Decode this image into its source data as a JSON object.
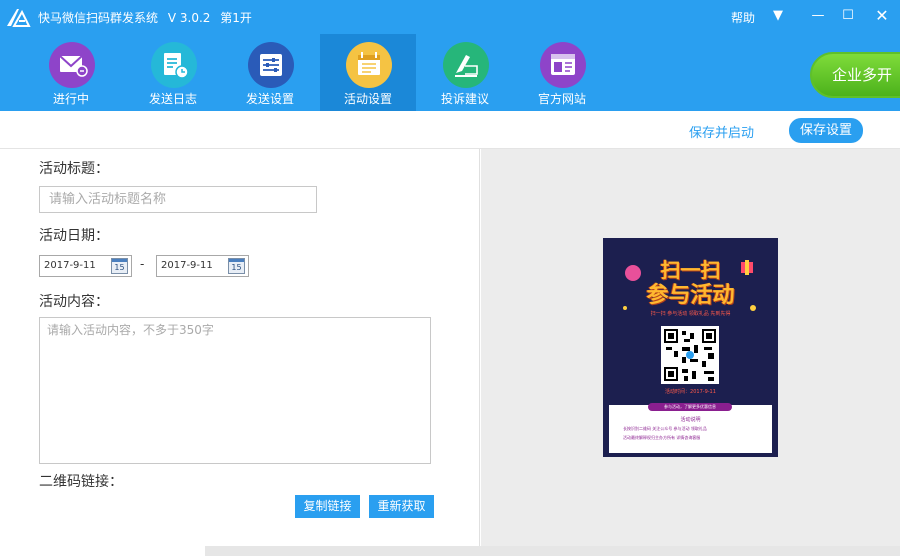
{
  "app": {
    "title": "快马微信扫码群发系统",
    "version": "V 3.0.2",
    "instance": "第1开"
  },
  "window": {
    "help": "帮助",
    "menu_glyph": "▼",
    "minimize_glyph": "—",
    "maximize_glyph": "☐",
    "close_glyph": "✕"
  },
  "nav": [
    {
      "label": "进行中",
      "icon": "mail-icon",
      "color": "#8e44c9"
    },
    {
      "label": "发送日志",
      "icon": "log-icon",
      "color": "#25b8d8"
    },
    {
      "label": "发送设置",
      "icon": "sliders-icon",
      "color": "#2a5bb8"
    },
    {
      "label": "活动设置",
      "icon": "calendar-icon",
      "color": "#f5c343"
    },
    {
      "label": "投诉建议",
      "icon": "feedback-icon",
      "color": "#26b67a"
    },
    {
      "label": "官方网站",
      "icon": "browser-icon",
      "color": "#8e44c9"
    }
  ],
  "active_nav": "活动设置",
  "enterprise_button": "企业多开",
  "toolbar": {
    "save_and_start": "保存并启动",
    "save_settings": "保存设置"
  },
  "form": {
    "title_label": "活动标题：",
    "title_placeholder": "请输入活动标题名称",
    "date_label": "活动日期：",
    "start_date": "2017-9-11",
    "end_date": "2017-9-11",
    "date_separator": "-",
    "calendar_day": "15",
    "content_label": "活动内容：",
    "content_placeholder": "请输入活动内容，不多于350字",
    "qr_label": "二维码链接：",
    "copy_link": "复制链接",
    "refresh": "重新获取"
  },
  "poster": {
    "title_line1": "扫一扫",
    "title_line2": "参与活动",
    "subtitle": "扫一扫 参与活动 领取礼品 先到先得",
    "qr_time": "活动时间：2017-9-11",
    "pill_text": "参与活动，了解更多优惠信息",
    "card_heading": "活动说明",
    "card_line1": "长按识别二维码 关注公众号 参与活动 领取礼品",
    "card_line2": "活动最终解释权归主办方所有 详情咨询客服"
  },
  "colors": {
    "header": "#2a9ff0",
    "active_tab": "#1b88d8",
    "accent": "#2a9ff0",
    "enterprise": "#5fc02a",
    "poster_bg": "#1c1f4f"
  }
}
